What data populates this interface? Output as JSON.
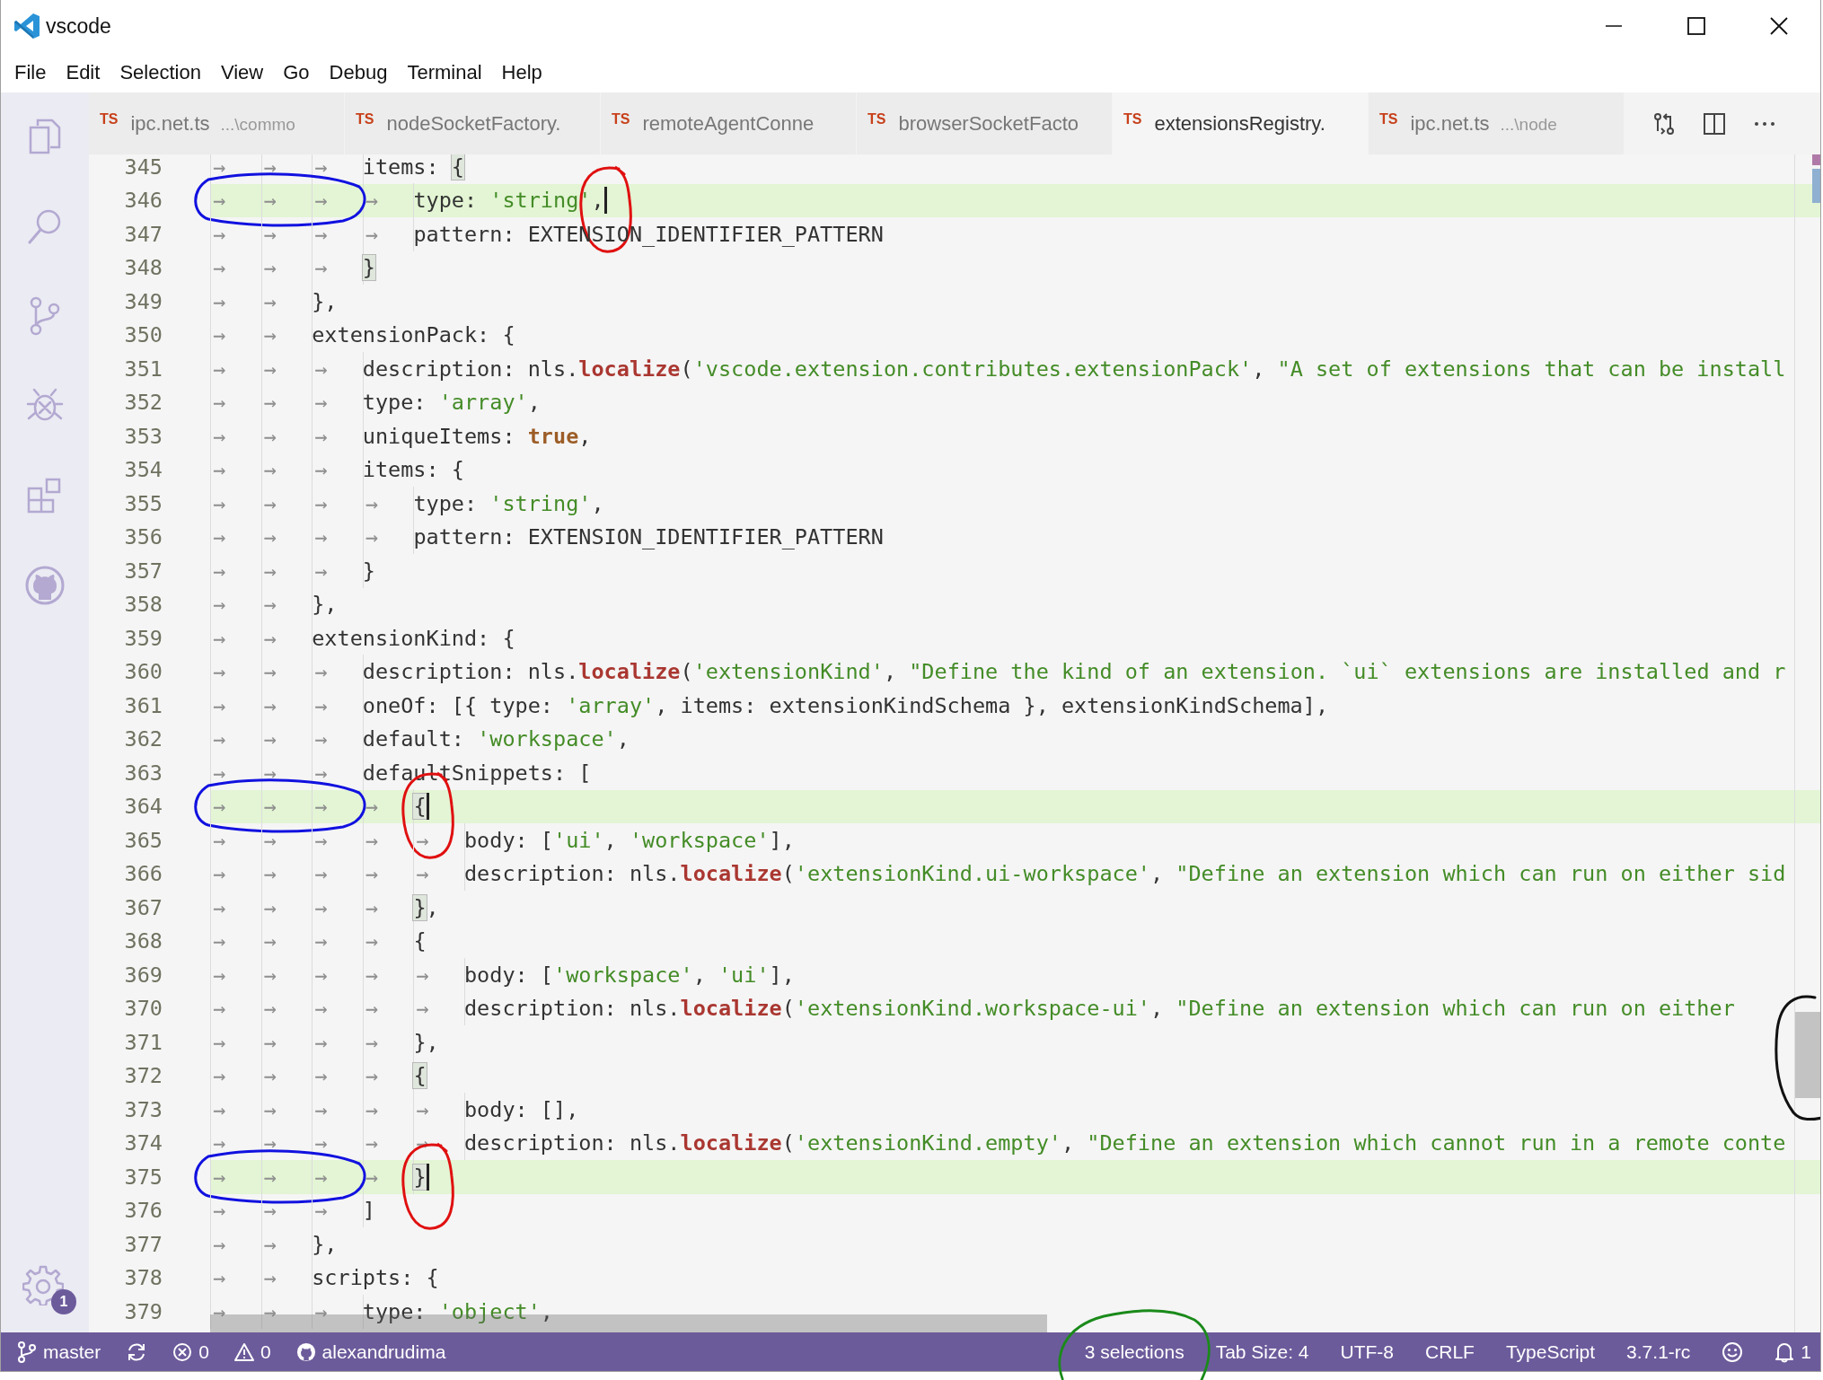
{
  "window": {
    "title": "vscode"
  },
  "menu": [
    "File",
    "Edit",
    "Selection",
    "View",
    "Go",
    "Debug",
    "Terminal",
    "Help"
  ],
  "activity_bar": [
    {
      "kind": "files"
    },
    {
      "kind": "search"
    },
    {
      "kind": "scm"
    },
    {
      "kind": "debug"
    },
    {
      "kind": "extensions"
    },
    {
      "kind": "github"
    }
  ],
  "manage": {
    "badge": "1"
  },
  "tabs": [
    {
      "icon": "TS",
      "label": "ipc.net.ts",
      "description": "...\\commo",
      "selected": false
    },
    {
      "icon": "TS",
      "label": "nodeSocketFactory.",
      "selected": false
    },
    {
      "icon": "TS",
      "label": "remoteAgentConne",
      "selected": false
    },
    {
      "icon": "TS",
      "label": "browserSocketFacto",
      "selected": false
    },
    {
      "icon": "TS",
      "label": "extensionsRegistry.",
      "selected": true
    },
    {
      "icon": "TS",
      "label": "ipc.net.ts",
      "description": "...\\node",
      "selected": false
    }
  ],
  "lines": [
    {
      "number": "345",
      "indent": "→→→",
      "tokens": [
        {
          "kind": "plain",
          "text": "items: "
        },
        {
          "kind": "bracket",
          "text": "{"
        }
      ],
      "highlighted": false,
      "cursor": false,
      "circled": false
    },
    {
      "number": "346",
      "indent": "→→→→",
      "tokens": [
        {
          "kind": "plain",
          "text": "type: "
        },
        {
          "kind": "string",
          "text": "'string'"
        },
        {
          "kind": "plain",
          "text": ","
        }
      ],
      "highlighted": true,
      "cursor": true,
      "circled": true
    },
    {
      "number": "347",
      "indent": "→→→→",
      "tokens": [
        {
          "kind": "plain",
          "text": "pattern: EXTENSION_IDENTIFIER_PATTERN"
        }
      ],
      "highlighted": false,
      "cursor": false,
      "circled": false
    },
    {
      "number": "348",
      "indent": "→→→",
      "tokens": [
        {
          "kind": "bracket",
          "text": "}"
        }
      ],
      "highlighted": false,
      "cursor": false,
      "circled": false
    },
    {
      "number": "349",
      "indent": "→→",
      "tokens": [
        {
          "kind": "plain",
          "text": "},"
        }
      ],
      "highlighted": false,
      "cursor": false,
      "circled": false
    },
    {
      "number": "350",
      "indent": "→→",
      "tokens": [
        {
          "kind": "plain",
          "text": "extensionPack: {"
        }
      ],
      "highlighted": false,
      "cursor": false,
      "circled": false
    },
    {
      "number": "351",
      "indent": "→→→",
      "tokens": [
        {
          "kind": "plain",
          "text": "description: nls."
        },
        {
          "kind": "func",
          "text": "localize"
        },
        {
          "kind": "plain",
          "text": "("
        },
        {
          "kind": "string",
          "text": "'vscode.extension.contributes.extensionPack'"
        },
        {
          "kind": "plain",
          "text": ", "
        },
        {
          "kind": "string",
          "text": "\"A set of extensions that can be install"
        }
      ],
      "highlighted": false,
      "cursor": false,
      "circled": false
    },
    {
      "number": "352",
      "indent": "→→→",
      "tokens": [
        {
          "kind": "plain",
          "text": "type: "
        },
        {
          "kind": "string",
          "text": "'array'"
        },
        {
          "kind": "plain",
          "text": ","
        }
      ],
      "highlighted": false,
      "cursor": false,
      "circled": false
    },
    {
      "number": "353",
      "indent": "→→→",
      "tokens": [
        {
          "kind": "plain",
          "text": "uniqueItems: "
        },
        {
          "kind": "keyword",
          "text": "true"
        },
        {
          "kind": "plain",
          "text": ","
        }
      ],
      "highlighted": false,
      "cursor": false,
      "circled": false
    },
    {
      "number": "354",
      "indent": "→→→",
      "tokens": [
        {
          "kind": "plain",
          "text": "items: {"
        }
      ],
      "highlighted": false,
      "cursor": false,
      "circled": false
    },
    {
      "number": "355",
      "indent": "→→→→",
      "tokens": [
        {
          "kind": "plain",
          "text": "type: "
        },
        {
          "kind": "string",
          "text": "'string'"
        },
        {
          "kind": "plain",
          "text": ","
        }
      ],
      "highlighted": false,
      "cursor": false,
      "circled": false
    },
    {
      "number": "356",
      "indent": "→→→→",
      "tokens": [
        {
          "kind": "plain",
          "text": "pattern: EXTENSION_IDENTIFIER_PATTERN"
        }
      ],
      "highlighted": false,
      "cursor": false,
      "circled": false
    },
    {
      "number": "357",
      "indent": "→→→",
      "tokens": [
        {
          "kind": "plain",
          "text": "}"
        }
      ],
      "highlighted": false,
      "cursor": false,
      "circled": false
    },
    {
      "number": "358",
      "indent": "→→",
      "tokens": [
        {
          "kind": "plain",
          "text": "},"
        }
      ],
      "highlighted": false,
      "cursor": false,
      "circled": false
    },
    {
      "number": "359",
      "indent": "→→",
      "tokens": [
        {
          "kind": "plain",
          "text": "extensionKind: {"
        }
      ],
      "highlighted": false,
      "cursor": false,
      "circled": false
    },
    {
      "number": "360",
      "indent": "→→→",
      "tokens": [
        {
          "kind": "plain",
          "text": "description: nls."
        },
        {
          "kind": "func",
          "text": "localize"
        },
        {
          "kind": "plain",
          "text": "("
        },
        {
          "kind": "string",
          "text": "'extensionKind'"
        },
        {
          "kind": "plain",
          "text": ", "
        },
        {
          "kind": "string",
          "text": "\"Define the kind of an extension. `ui` extensions are installed and r"
        }
      ],
      "highlighted": false,
      "cursor": false,
      "circled": false
    },
    {
      "number": "361",
      "indent": "→→→",
      "tokens": [
        {
          "kind": "plain",
          "text": "oneOf: [{ type: "
        },
        {
          "kind": "string",
          "text": "'array'"
        },
        {
          "kind": "plain",
          "text": ", items: extensionKindSchema }, extensionKindSchema],"
        }
      ],
      "highlighted": false,
      "cursor": false,
      "circled": false
    },
    {
      "number": "362",
      "indent": "→→→",
      "tokens": [
        {
          "kind": "plain",
          "text": "default: "
        },
        {
          "kind": "string",
          "text": "'workspace'"
        },
        {
          "kind": "plain",
          "text": ","
        }
      ],
      "highlighted": false,
      "cursor": false,
      "circled": false
    },
    {
      "number": "363",
      "indent": "→→→",
      "tokens": [
        {
          "kind": "plain",
          "text": "defaultSnippets: ["
        }
      ],
      "highlighted": false,
      "cursor": false,
      "circled": false
    },
    {
      "number": "364",
      "indent": "→→→→",
      "tokens": [
        {
          "kind": "bracket",
          "text": "{"
        }
      ],
      "highlighted": true,
      "cursor": true,
      "circled": true
    },
    {
      "number": "365",
      "indent": "→→→→→",
      "tokens": [
        {
          "kind": "plain",
          "text": "body: ["
        },
        {
          "kind": "string",
          "text": "'ui'"
        },
        {
          "kind": "plain",
          "text": ", "
        },
        {
          "kind": "string",
          "text": "'workspace'"
        },
        {
          "kind": "plain",
          "text": "],"
        }
      ],
      "highlighted": false,
      "cursor": false,
      "circled": false
    },
    {
      "number": "366",
      "indent": "→→→→→",
      "tokens": [
        {
          "kind": "plain",
          "text": "description: nls."
        },
        {
          "kind": "func",
          "text": "localize"
        },
        {
          "kind": "plain",
          "text": "("
        },
        {
          "kind": "string",
          "text": "'extensionKind.ui-workspace'"
        },
        {
          "kind": "plain",
          "text": ", "
        },
        {
          "kind": "string",
          "text": "\"Define an extension which can run on either sid"
        }
      ],
      "highlighted": false,
      "cursor": false,
      "circled": false
    },
    {
      "number": "367",
      "indent": "→→→→",
      "tokens": [
        {
          "kind": "bracket",
          "text": "}"
        },
        {
          "kind": "plain",
          "text": ","
        }
      ],
      "highlighted": false,
      "cursor": false,
      "circled": false
    },
    {
      "number": "368",
      "indent": "→→→→",
      "tokens": [
        {
          "kind": "plain",
          "text": "{"
        }
      ],
      "highlighted": false,
      "cursor": false,
      "circled": false
    },
    {
      "number": "369",
      "indent": "→→→→→",
      "tokens": [
        {
          "kind": "plain",
          "text": "body: ["
        },
        {
          "kind": "string",
          "text": "'workspace'"
        },
        {
          "kind": "plain",
          "text": ", "
        },
        {
          "kind": "string",
          "text": "'ui'"
        },
        {
          "kind": "plain",
          "text": "],"
        }
      ],
      "highlighted": false,
      "cursor": false,
      "circled": false
    },
    {
      "number": "370",
      "indent": "→→→→→",
      "tokens": [
        {
          "kind": "plain",
          "text": "description: nls."
        },
        {
          "kind": "func",
          "text": "localize"
        },
        {
          "kind": "plain",
          "text": "("
        },
        {
          "kind": "string",
          "text": "'extensionKind.workspace-ui'"
        },
        {
          "kind": "plain",
          "text": ", "
        },
        {
          "kind": "string",
          "text": "\"Define an extension which can run on either"
        }
      ],
      "highlighted": false,
      "cursor": false,
      "circled": false
    },
    {
      "number": "371",
      "indent": "→→→→",
      "tokens": [
        {
          "kind": "plain",
          "text": "},"
        }
      ],
      "highlighted": false,
      "cursor": false,
      "circled": false
    },
    {
      "number": "372",
      "indent": "→→→→",
      "tokens": [
        {
          "kind": "bracket",
          "text": "{"
        }
      ],
      "highlighted": false,
      "cursor": false,
      "circled": false
    },
    {
      "number": "373",
      "indent": "→→→→→",
      "tokens": [
        {
          "kind": "plain",
          "text": "body: [],"
        }
      ],
      "highlighted": false,
      "cursor": false,
      "circled": false
    },
    {
      "number": "374",
      "indent": "→→→→→",
      "tokens": [
        {
          "kind": "plain",
          "text": "description: nls."
        },
        {
          "kind": "func",
          "text": "localize"
        },
        {
          "kind": "plain",
          "text": "("
        },
        {
          "kind": "string",
          "text": "'extensionKind.empty'"
        },
        {
          "kind": "plain",
          "text": ", "
        },
        {
          "kind": "string",
          "text": "\"Define an extension which cannot run in a remote conte"
        }
      ],
      "highlighted": false,
      "cursor": false,
      "circled": false
    },
    {
      "number": "375",
      "indent": "→→→→",
      "tokens": [
        {
          "kind": "bracket",
          "text": "}"
        }
      ],
      "highlighted": true,
      "cursor": true,
      "circled": true
    },
    {
      "number": "376",
      "indent": "→→→",
      "tokens": [
        {
          "kind": "plain",
          "text": "]"
        }
      ],
      "highlighted": false,
      "cursor": false,
      "circled": false
    },
    {
      "number": "377",
      "indent": "→→",
      "tokens": [
        {
          "kind": "plain",
          "text": "},"
        }
      ],
      "highlighted": false,
      "cursor": false,
      "circled": false
    },
    {
      "number": "378",
      "indent": "→→",
      "tokens": [
        {
          "kind": "plain",
          "text": "scripts: {"
        }
      ],
      "highlighted": false,
      "cursor": false,
      "circled": false
    },
    {
      "number": "379",
      "indent": "→→→",
      "tokens": [
        {
          "kind": "plain",
          "text": "type: "
        },
        {
          "kind": "string",
          "text": "'object'"
        },
        {
          "kind": "plain",
          "text": ","
        }
      ],
      "highlighted": false,
      "cursor": false,
      "circled": false
    }
  ],
  "status_bar": {
    "left": [
      {
        "kind": "branch",
        "text": "master"
      },
      {
        "kind": "sync"
      },
      {
        "kind": "errors",
        "text": "0"
      },
      {
        "kind": "warnings",
        "text": "0"
      },
      {
        "kind": "github",
        "text": "alexandrudima"
      }
    ],
    "right": [
      {
        "kind": "text",
        "text": "3 selections",
        "circled": true
      },
      {
        "kind": "text",
        "text": "Tab Size: 4",
        "circled": false
      },
      {
        "kind": "text",
        "text": "UTF-8",
        "circled": false
      },
      {
        "kind": "text",
        "text": "CRLF",
        "circled": false
      },
      {
        "kind": "text",
        "text": "TypeScript",
        "circled": false
      },
      {
        "kind": "text",
        "text": "3.7.1-rc",
        "circled": false
      },
      {
        "kind": "smiley"
      },
      {
        "kind": "bell",
        "text": "1"
      }
    ]
  }
}
